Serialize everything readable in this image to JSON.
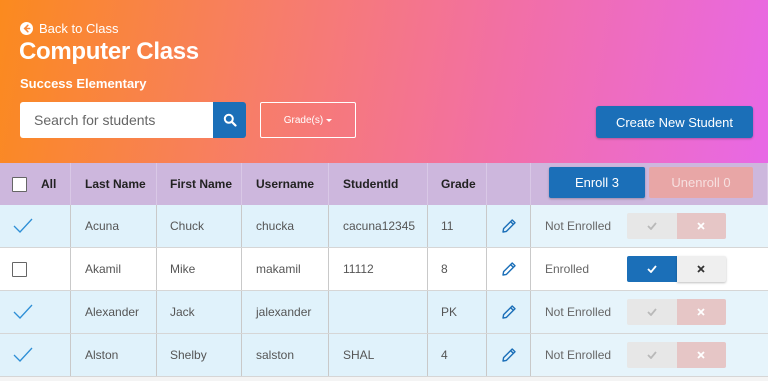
{
  "header": {
    "back_label": "Back to Class",
    "title": "Computer Class",
    "school": "Success Elementary",
    "search_placeholder": "Search for students",
    "grade_filter_label": "Grade(s)",
    "create_button": "Create New Student"
  },
  "table": {
    "columns": {
      "all": "All",
      "last_name": "Last Name",
      "first_name": "First Name",
      "username": "Username",
      "student_id": "StudentId",
      "grade": "Grade"
    },
    "enroll_button": "Enroll 3",
    "unenroll_button": "Unenroll 0",
    "rows": [
      {
        "selected": true,
        "last": "Acuna",
        "first": "Chuck",
        "username": "chucka",
        "id": "cacuna12345",
        "grade": "11",
        "status": "Not Enrolled",
        "enrolled": false
      },
      {
        "selected": false,
        "last": "Akamil",
        "first": "Mike",
        "username": "makamil",
        "id": "11112",
        "grade": "8",
        "status": "Enrolled",
        "enrolled": true
      },
      {
        "selected": true,
        "last": "Alexander",
        "first": "Jack",
        "username": "jalexander",
        "id": "",
        "grade": "PK",
        "status": "Not Enrolled",
        "enrolled": false
      },
      {
        "selected": true,
        "last": "Alston",
        "first": "Shelby",
        "username": "salston",
        "id": "SHAL",
        "grade": "4",
        "status": "Not Enrolled",
        "enrolled": false
      }
    ]
  },
  "colors": {
    "primary_blue": "#1b6fb8",
    "header_gradient_start": "#fb8a1e",
    "header_gradient_end": "#e868e6",
    "table_header_bg": "#cdb7dd",
    "selected_row_bg": "#e0f2fb",
    "unenroll_disabled": "#e8a6a6"
  }
}
